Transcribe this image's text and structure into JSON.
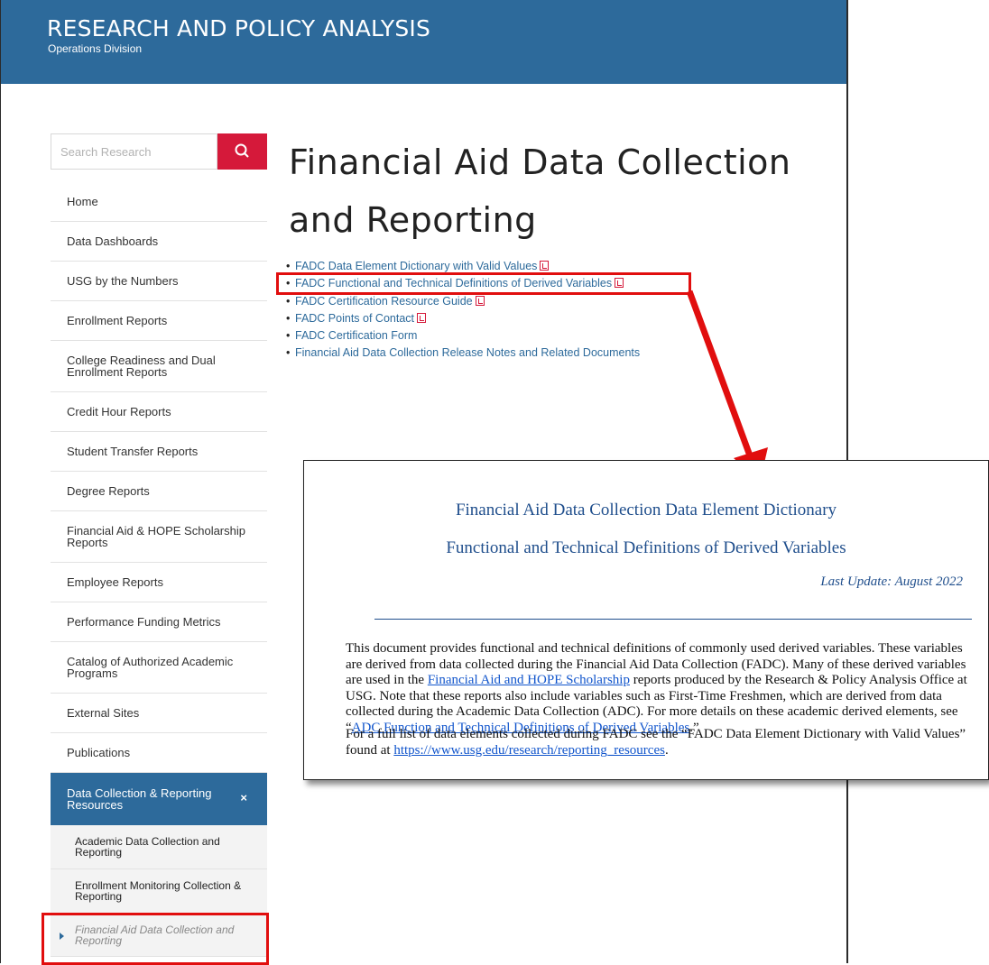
{
  "header": {
    "title": "RESEARCH AND POLICY ANALYSIS",
    "subtitle": "Operations Division"
  },
  "search": {
    "placeholder": "Search Research",
    "button_icon": "search-icon"
  },
  "nav": {
    "items": [
      "Home",
      "Data Dashboards",
      "USG by the Numbers",
      "Enrollment Reports",
      "College Readiness and Dual Enrollment Reports",
      "Credit Hour Reports",
      "Student Transfer Reports",
      "Degree Reports",
      "Financial Aid & HOPE Scholarship Reports",
      "Employee Reports",
      "Performance Funding Metrics",
      "Catalog of Authorized Academic Programs",
      "External Sites",
      "Publications"
    ],
    "active": {
      "label": "Data Collection & Reporting Resources",
      "close_icon": "×"
    },
    "subitems": [
      "Academic Data Collection and Reporting",
      "Enrollment Monitoring Collection & Reporting",
      "Financial Aid Data Collection and Reporting"
    ]
  },
  "main": {
    "title": "Financial Aid Data Collection and Reporting",
    "links": [
      {
        "label": "FADC Data Element Dictionary with Valid Values",
        "pdf": true
      },
      {
        "label": "FADC Functional and Technical Definitions of Derived Variables",
        "pdf": true
      },
      {
        "label": "FADC Certification Resource Guide",
        "pdf": true
      },
      {
        "label": "FADC Points of Contact",
        "pdf": true
      },
      {
        "label": "FADC Certification Form",
        "pdf": false
      },
      {
        "label": "Financial Aid Data Collection Release Notes and Related Documents",
        "pdf": false
      }
    ]
  },
  "document": {
    "heading1": "Financial Aid Data Collection Data Element Dictionary",
    "heading2": "Functional and Technical Definitions of Derived Variables",
    "last_update": "Last Update: August 2022",
    "p1_before": "This document provides functional and technical definitions of commonly used derived variables. These variables are derived from data collected during the Financial Aid Data Collection (FADC). Many of these derived variables are used in the ",
    "p1_link1": "Financial Aid and HOPE Scholarship",
    "p1_mid": " reports produced by the Research & Policy Analysis Office at USG. Note that these reports also include variables such as First-Time Freshmen, which are derived from data collected during the Academic Data Collection (ADC). For more details on these academic derived elements, see “",
    "p1_link2": "ADC Function and Technical Definitions of Derived Variables",
    "p1_end": ".”",
    "p2_before": "For a full list of data elements collected during FADC see the “FADC Data Element Dictionary with Valid Values” found at ",
    "p2_link": "https://www.usg.edu/research/reporting_resources",
    "p2_end": "."
  },
  "colors": {
    "header_blue": "#2d6a9b",
    "search_red": "#d5193a",
    "highlight_red": "#e10e0e",
    "doc_heading": "#1f4e8c"
  }
}
